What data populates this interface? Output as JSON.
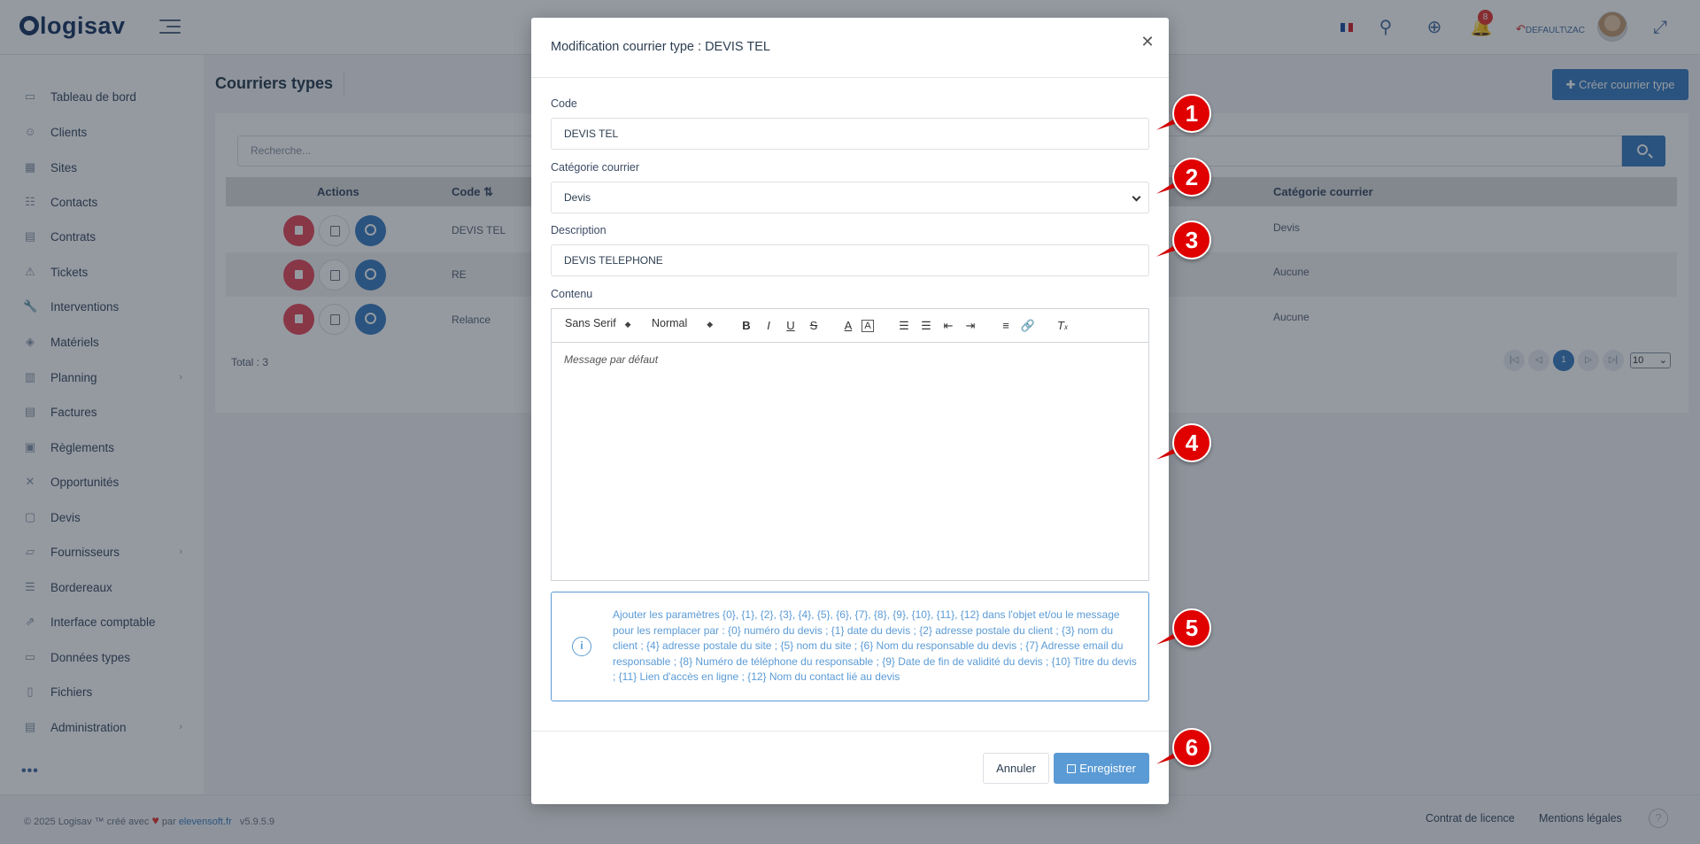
{
  "app": {
    "logo_text": "logisav",
    "user": "DEFAULT\\ZAC",
    "notification_count": "8"
  },
  "sidebar": {
    "items": [
      {
        "label": "Tableau de bord",
        "icon": "dashboard-icon"
      },
      {
        "label": "Clients",
        "icon": "user-icon"
      },
      {
        "label": "Sites",
        "icon": "building-icon"
      },
      {
        "label": "Contacts",
        "icon": "address-book-icon"
      },
      {
        "label": "Contrats",
        "icon": "contract-icon"
      },
      {
        "label": "Tickets",
        "icon": "warning-icon"
      },
      {
        "label": "Interventions",
        "icon": "wrench-icon"
      },
      {
        "label": "Matériels",
        "icon": "cube-icon"
      },
      {
        "label": "Planning",
        "icon": "calendar-icon",
        "has_children": true
      },
      {
        "label": "Factures",
        "icon": "invoice-icon"
      },
      {
        "label": "Règlements",
        "icon": "payment-icon"
      },
      {
        "label": "Opportunités",
        "icon": "opportunity-icon"
      },
      {
        "label": "Devis",
        "icon": "briefcase-icon"
      },
      {
        "label": "Fournisseurs",
        "icon": "supplier-icon",
        "has_children": true
      },
      {
        "label": "Bordereaux",
        "icon": "stack-icon"
      },
      {
        "label": "Interface comptable",
        "icon": "external-link-icon"
      },
      {
        "label": "Données types",
        "icon": "folder-icon"
      },
      {
        "label": "Fichiers",
        "icon": "file-icon"
      },
      {
        "label": "Administration",
        "icon": "admin-icon",
        "has_children": true
      }
    ]
  },
  "page": {
    "title": "Courriers types",
    "create_button": "Créer courrier type",
    "search_placeholder": "Recherche...",
    "columns": {
      "actions": "Actions",
      "code": "Code",
      "category": "Catégorie courrier"
    },
    "rows": [
      {
        "code": "DEVIS TEL",
        "category": "Devis"
      },
      {
        "code": "RE",
        "category": "Aucune"
      },
      {
        "code": "Relance",
        "category": "Aucune"
      }
    ],
    "total": "Total : 3",
    "current_page": "1",
    "page_size": "10"
  },
  "footer": {
    "copyright": "© 2025 Logisav ™ créé avec",
    "by": "par",
    "company": "elevensoft.fr",
    "version": "v5.9.5.9",
    "license": "Contrat de licence",
    "legal": "Mentions légales"
  },
  "modal": {
    "title": "Modification courrier type : DEVIS TEL",
    "code_label": "Code",
    "code_value": "DEVIS TEL",
    "category_label": "Catégorie courrier",
    "category_value": "Devis",
    "description_label": "Description",
    "description_value": "DEVIS TELEPHONE",
    "content_label": "Contenu",
    "font_select": "Sans Serif",
    "size_select": "Normal",
    "editor_placeholder": "Message par défaut",
    "info_text": "Ajouter les paramètres {0}, {1}, {2}, {3}, {4}, {5}, {6}, {7}, {8}, {9}, {10}, {11}, {12} dans l'objet et/ou le message pour les remplacer par : {0} numéro du devis ; {1} date du devis ; {2} adresse postale du client ; {3} nom du client ; {4} adresse postale du site ; {5} nom du site ; {6} Nom du responsable du devis ; {7} Adresse email du responsable ; {8} Numéro de téléphone du responsable ; {9} Date de fin de validité du devis ; {10} Titre du devis ; {11} Lien d'accès en ligne ; {12} Nom du contact lié au devis",
    "cancel_button": "Annuler",
    "save_button": "Enregistrer"
  },
  "markers": [
    "1",
    "2",
    "3",
    "4",
    "5",
    "6"
  ],
  "colors": {
    "primary": "#3d7ec4",
    "danger": "#e74c5e",
    "marker_red": "#e00000",
    "info_blue": "#5b9bd5"
  }
}
